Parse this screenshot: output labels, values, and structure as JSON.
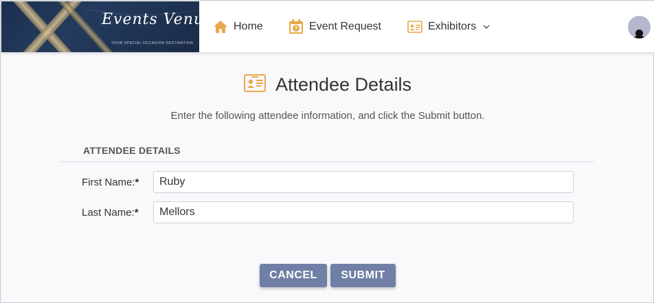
{
  "header": {
    "logo_title": "Events Venue",
    "logo_subtitle": "YOUR SPECIAL OCCASION DESTINATION",
    "nav": {
      "home": {
        "label": "Home",
        "icon": "home-icon"
      },
      "event_request": {
        "label": "Event Request",
        "icon": "calendar-question-icon"
      },
      "exhibitors": {
        "label": "Exhibitors",
        "icon": "id-card-icon",
        "dropdown_icon": "chevron-down-icon"
      }
    },
    "avatar_icon": "user-avatar-icon"
  },
  "main": {
    "title": "Attendee Details",
    "title_icon": "id-card-icon",
    "intro": "Enter the following attendee information, and click the Submit button.",
    "section_title": "ATTENDEE DETAILS",
    "fields": {
      "first_name": {
        "label": "First Name:",
        "required_mark": "*",
        "value": "Ruby"
      },
      "last_name": {
        "label": "Last Name:",
        "required_mark": "*",
        "value": "Mellors"
      }
    },
    "buttons": {
      "cancel": "CANCEL",
      "submit": "SUBMIT"
    }
  },
  "colors": {
    "accent_icon": "#e8a84a",
    "button": "#6f7fa5",
    "header_logo_bg": "#1c2f4f",
    "page_bg": "#f9f9fc"
  }
}
